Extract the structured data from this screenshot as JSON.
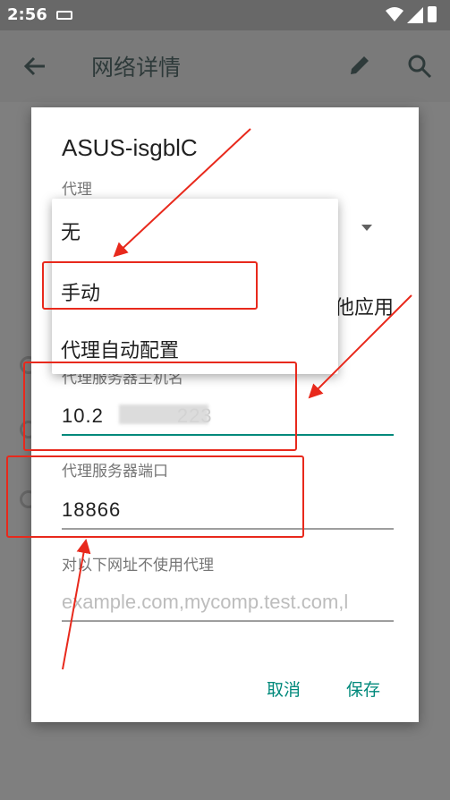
{
  "status_bar": {
    "time": "2:56"
  },
  "toolbar": {
    "title": "网络详情"
  },
  "dialog": {
    "network_name": "ASUS-isgblC",
    "proxy_label": "代理",
    "apply_partial_text": "他应用",
    "proxy_host_label": "代理服务器主机名",
    "proxy_host_value": "10.2",
    "proxy_host_value_tail": "223",
    "proxy_port_label": "代理服务器端口",
    "proxy_port_value": "18866",
    "bypass_label": "对以下网址不使用代理",
    "bypass_placeholder": "example.com,mycomp.test.com,l",
    "cancel_label": "取消",
    "save_label": "保存"
  },
  "proxy_menu": {
    "options": [
      "无",
      "手动",
      "代理自动配置"
    ],
    "selected": "手动"
  },
  "annotation": {
    "color": "#e8291c"
  }
}
